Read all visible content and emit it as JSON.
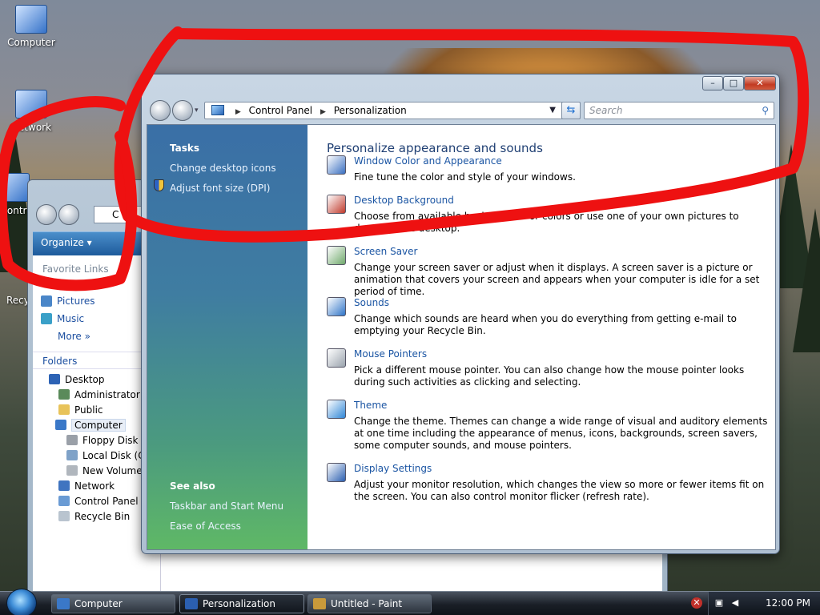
{
  "desktop": {
    "icons": [
      {
        "label": "Computer"
      },
      {
        "label": "Network"
      },
      {
        "label": "Contr"
      },
      {
        "label": "Recy"
      }
    ]
  },
  "explorer": {
    "organize_label": "Organize",
    "address_fragment": "C",
    "favorite_links_label": "Favorite Links",
    "favorites": [
      "Pictures",
      "Music",
      "More"
    ],
    "folders_label": "Folders",
    "tree": [
      "Desktop",
      "Administrator",
      "Public",
      "Computer",
      "Floppy Disk Dr",
      "Local Disk (C:)",
      "New Volume (",
      "Network",
      "Control Panel",
      "Recycle Bin"
    ]
  },
  "window": {
    "title_buttons": {
      "minimize": "–",
      "maximize": "□",
      "close": "✕"
    },
    "breadcrumb": [
      "Control Panel",
      "Personalization"
    ],
    "search_placeholder": "Search"
  },
  "left_pane": {
    "tasks_heading": "Tasks",
    "tasks": [
      "Change desktop icons",
      "Adjust font size (DPI)"
    ],
    "see_also_heading": "See also",
    "see_also": [
      "Taskbar and Start Menu",
      "Ease of Access"
    ]
  },
  "main": {
    "heading": "Personalize appearance and sounds",
    "items": [
      {
        "title": "Window Color and Appearance",
        "desc": "Fine tune the color and style of your windows.",
        "icon": "window-color-icon",
        "color": "#3a6fc0"
      },
      {
        "title": "Desktop Background",
        "desc": "Choose from available backgrounds or colors or use one of your own pictures to decorate the desktop.",
        "icon": "desktop-background-icon",
        "color": "#c0392b"
      },
      {
        "title": "Screen Saver",
        "desc": "Change your screen saver or adjust when it displays. A screen saver is a picture or animation that covers your screen and appears when your computer is idle for a set period of time.",
        "icon": "screen-saver-icon",
        "color": "#6fa86b"
      },
      {
        "title": "Sounds",
        "desc": "Change which sounds are heard when you do everything from getting e-mail to emptying your Recycle Bin.",
        "icon": "sounds-icon",
        "color": "#2f74c7"
      },
      {
        "title": "Mouse Pointers",
        "desc": "Pick a different mouse pointer. You can also change how the mouse pointer looks during such activities as clicking and selecting.",
        "icon": "mouse-pointer-icon",
        "color": "#9aa3ad"
      },
      {
        "title": "Theme",
        "desc": "Change the theme. Themes can change a wide range of visual and auditory elements at one time including the appearance of menus, icons, backgrounds, screen savers, some computer sounds, and mouse pointers.",
        "icon": "theme-icon",
        "color": "#2f86d6"
      },
      {
        "title": "Display Settings",
        "desc": "Adjust your monitor resolution, which changes the view so more or fewer items fit on the screen. You can also control monitor flicker (refresh rate).",
        "icon": "display-settings-icon",
        "color": "#2b5fb0"
      }
    ]
  },
  "taskbar": {
    "buttons": [
      {
        "label": "Computer",
        "active": false
      },
      {
        "label": "Personalization",
        "active": true
      },
      {
        "label": "Untitled - Paint",
        "active": false
      }
    ],
    "clock": "12:00 PM"
  }
}
